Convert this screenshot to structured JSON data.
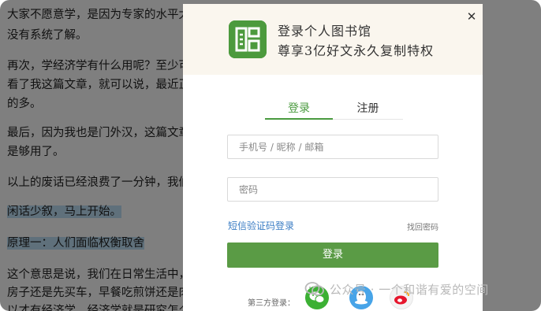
{
  "article": {
    "line_1": "大家不愿意学，是因为专家的水平太低",
    "line_2": "没有系统了解。",
    "line_3": "再次，学经济学有什么用呢？至少可以",
    "line_4": "看了我这篇文章，就可以说，最近正在",
    "line_5": "的多。",
    "line_6": "最后，因为我也是门外汉，这篇文章写",
    "line_7": "是够用了。",
    "line_8": "以上的废话已经浪费了一分钟，我们现",
    "line_9": "闲话少叙，马上开始。",
    "line_10": "原理一：人们面临权衡取舍",
    "line_11": "这个意思是说，我们在日常生活中，总",
    "line_12": "房子还是先买车，早餐吃煎饼还是肉夹",
    "line_13": "以才有经济学，经济学就是研究怎么"
  },
  "modal": {
    "header_title": "登录个人图书馆",
    "header_subtitle": "尊享3亿好文永久复制特权",
    "close_glyph": "✕",
    "tabs": [
      {
        "label": "登录"
      },
      {
        "label": "注册"
      }
    ],
    "account_placeholder": "手机号 / 昵称 / 邮箱",
    "password_placeholder": "密码",
    "sms_login_label": "短信验证码登录",
    "forgot_password_label": "找回密码",
    "login_button_label": "登录",
    "third_party_label": "第三方登录："
  },
  "watermark": {
    "text": "公众号 · 一个和谐有爱的空间"
  },
  "colors": {
    "accent_green": "#5a9b45",
    "link_blue": "#3b7dc4",
    "highlight": "#bfe0f7",
    "header_bg": "#faf6ee",
    "wechat": "#3cb034",
    "qq": "#47a4e8",
    "weibo": "#e6162d"
  },
  "icons": {
    "logo": "library-logo-icon",
    "close": "close-icon",
    "wechat": "wechat-icon",
    "qq": "qq-icon",
    "weibo": "weibo-icon",
    "watermark": "wechat-official-account-icon"
  }
}
